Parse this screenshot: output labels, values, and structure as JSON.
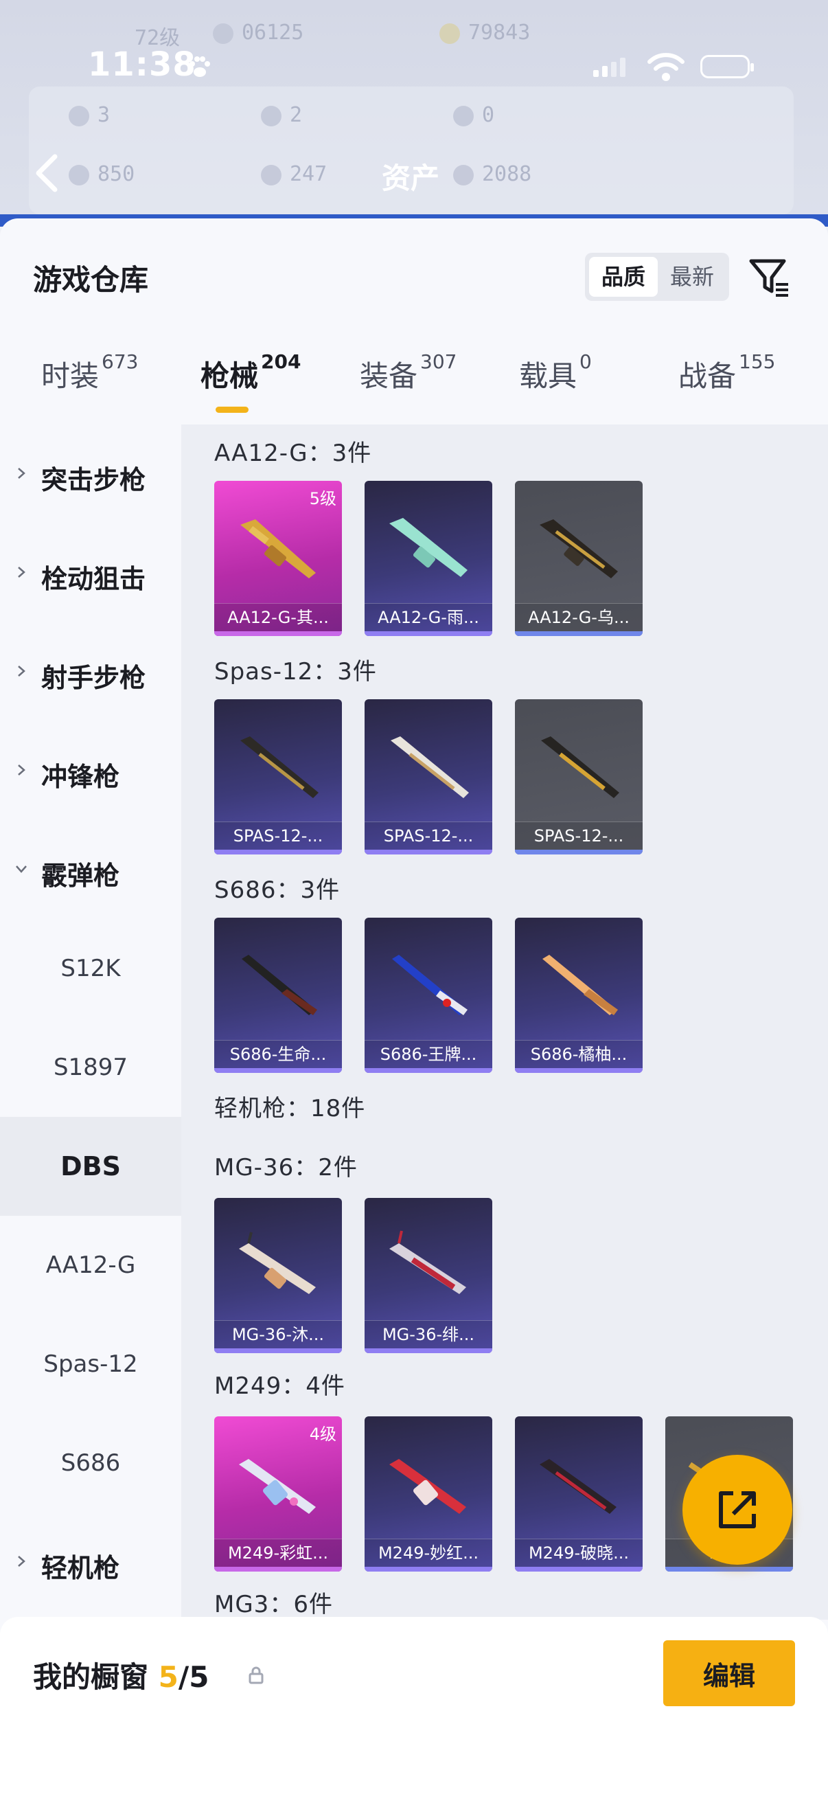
{
  "status_bar": {
    "time": "11:38"
  },
  "background": {
    "title": "资产",
    "stats": [
      "72级",
      "06125",
      "79843",
      "3",
      "2",
      "0",
      "850",
      "247",
      "2088"
    ]
  },
  "sheet": {
    "title": "游戏仓库",
    "sort": {
      "active": "品质",
      "inactive": "最新"
    },
    "tabs": [
      {
        "label": "时装",
        "count": "673"
      },
      {
        "label": "枪械",
        "count": "204"
      },
      {
        "label": "装备",
        "count": "307"
      },
      {
        "label": "载具",
        "count": "0"
      },
      {
        "label": "战备",
        "count": "155"
      }
    ],
    "active_tab": "枪械"
  },
  "sidebar": {
    "categories": [
      "突击步枪",
      "栓动狙击",
      "射手步枪",
      "冲锋枪",
      "霰弹枪"
    ],
    "subitems": [
      "S12K",
      "S1897",
      "DBS",
      "AA12-G",
      "Spas-12",
      "S686"
    ],
    "selected_sub": "DBS",
    "bottom_category": "轻机枪"
  },
  "groups": [
    {
      "title": "AA12-G：3件",
      "items": [
        {
          "name": "AA12-G-其...",
          "rarity": "pink",
          "level": "5级"
        },
        {
          "name": "AA12-G-雨...",
          "rarity": "purple"
        },
        {
          "name": "AA12-G-乌...",
          "rarity": "grey"
        }
      ]
    },
    {
      "title": "Spas-12：3件",
      "items": [
        {
          "name": "SPAS-12-...",
          "rarity": "purple"
        },
        {
          "name": "SPAS-12-...",
          "rarity": "purple"
        },
        {
          "name": "SPAS-12-...",
          "rarity": "grey"
        }
      ]
    },
    {
      "title": "S686：3件",
      "items": [
        {
          "name": "S686-生命...",
          "rarity": "purple"
        },
        {
          "name": "S686-王牌...",
          "rarity": "purple"
        },
        {
          "name": "S686-橘柚...",
          "rarity": "purple"
        }
      ]
    },
    {
      "title": "轻机枪：18件"
    },
    {
      "title": "MG-36：2件",
      "items": [
        {
          "name": "MG-36-沐...",
          "rarity": "purple"
        },
        {
          "name": "MG-36-绯...",
          "rarity": "purple"
        }
      ]
    },
    {
      "title": "M249：4件",
      "items": [
        {
          "name": "M249-彩虹...",
          "rarity": "pink",
          "level": "4级"
        },
        {
          "name": "M249-妙红...",
          "rarity": "purple"
        },
        {
          "name": "M249-破晓...",
          "rarity": "purple"
        },
        {
          "name": "M2...",
          "rarity": "grey"
        }
      ]
    },
    {
      "title": "MG3：6件"
    }
  ],
  "bottom_bar": {
    "label": "我的橱窗",
    "current": "5",
    "total": "/5",
    "edit_label": "编辑"
  },
  "colors": {
    "accent": "#f3b31a",
    "purple_rarity": "#3c3a78",
    "pink_rarity": "#b62ca8",
    "grey_rarity": "#5a5c66"
  },
  "icons": [
    "back-icon",
    "filter-icon",
    "chevron-right-icon",
    "chevron-down-icon",
    "share-icon",
    "lock-icon",
    "paw-icon",
    "signal-icon",
    "wifi-icon",
    "battery-icon"
  ]
}
